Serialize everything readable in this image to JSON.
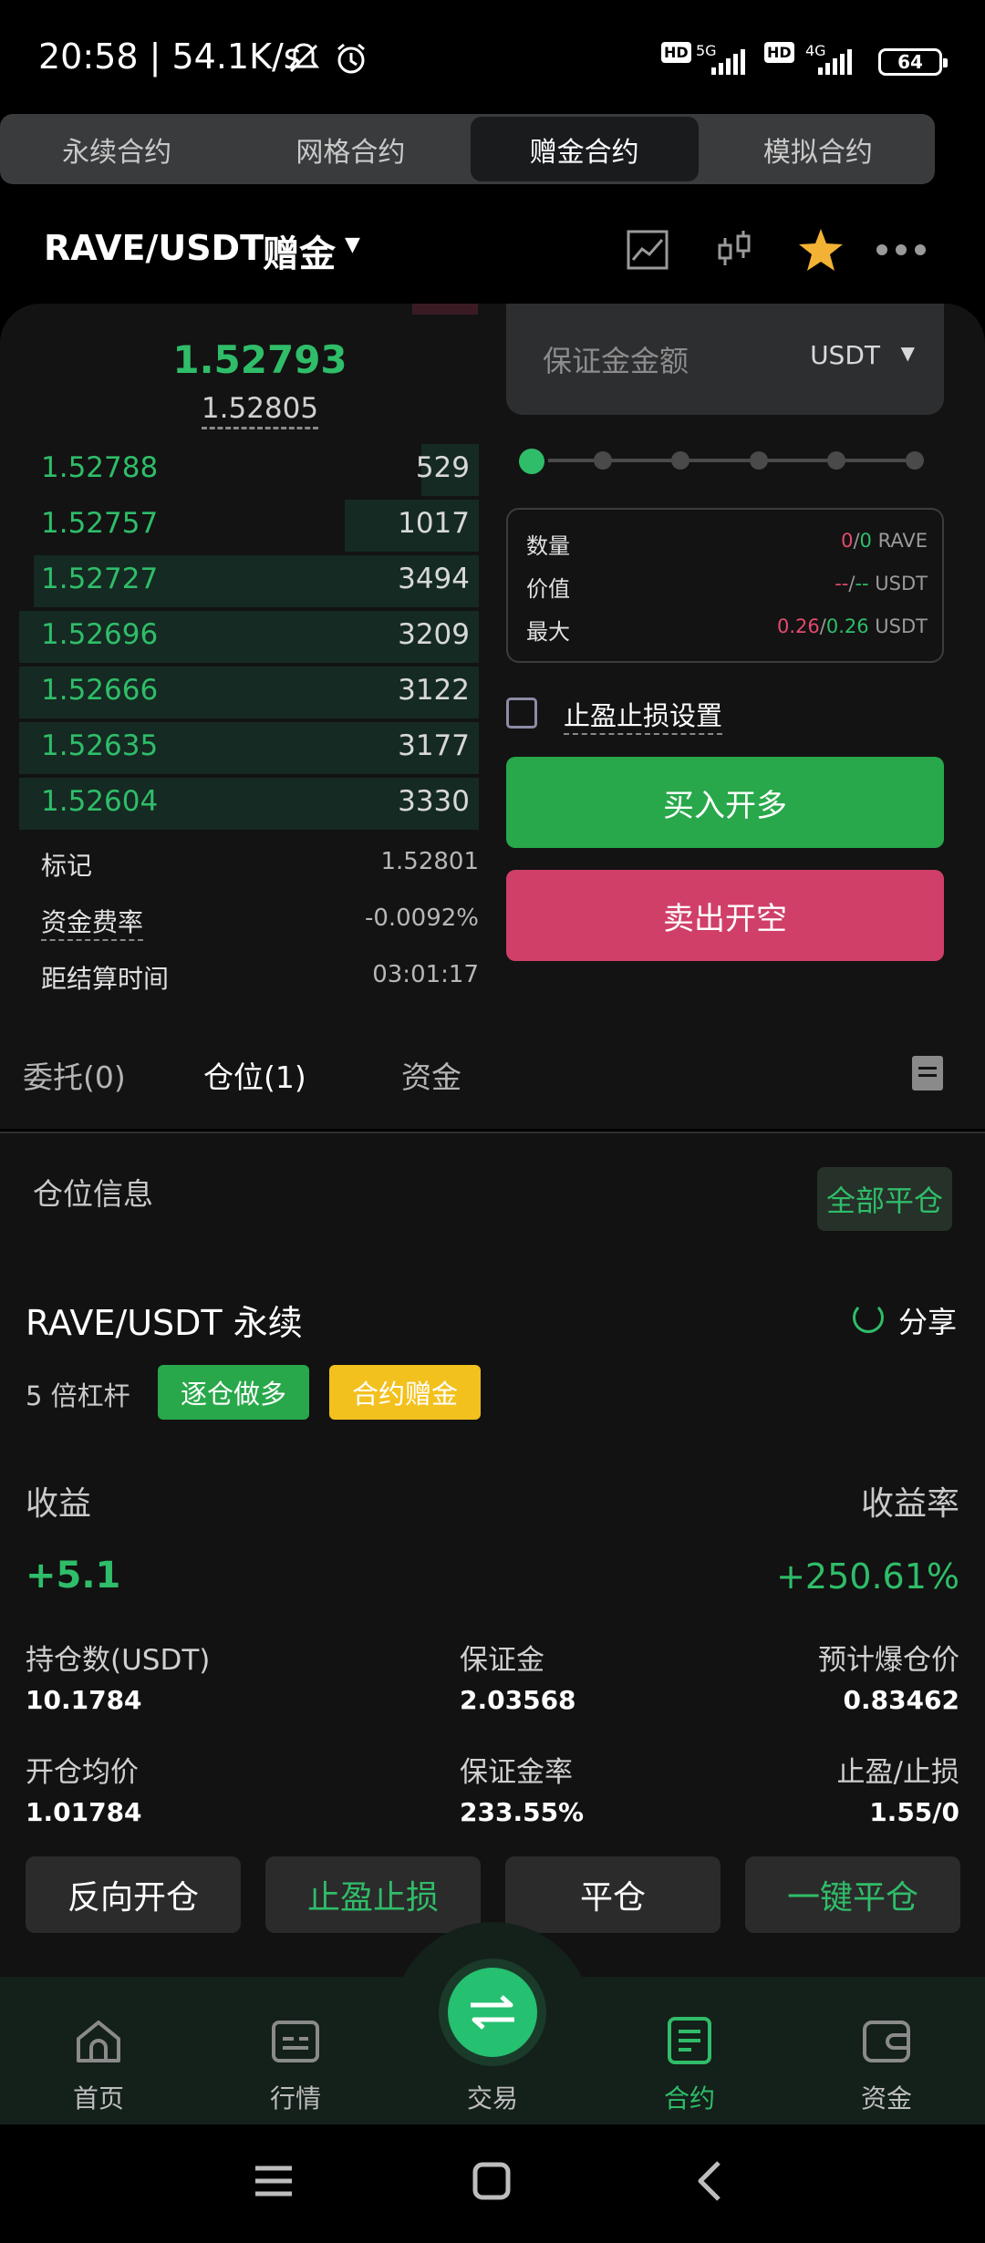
{
  "status_bar": {
    "time": "20:58 | 54.1K/s",
    "hd1": "HD",
    "net1": "5G",
    "hd2": "HD",
    "net2": "4G",
    "battery": "64"
  },
  "contract_tabs": [
    "永续合约",
    "网格合约",
    "赠金合约",
    "模拟合约"
  ],
  "pair_header": {
    "pair": "RAVE/USDT",
    "bonus_label": "赠金",
    "caret": "▼"
  },
  "orderbook": {
    "last_price": "1.52793",
    "index_price": "1.52805",
    "rows": [
      {
        "price": "1.52788",
        "qty": "529",
        "depth": 0.12
      },
      {
        "price": "1.52757",
        "qty": "1017",
        "depth": 0.28
      },
      {
        "price": "1.52727",
        "qty": "3494",
        "depth": 0.93
      },
      {
        "price": "1.52696",
        "qty": "3209",
        "depth": 0.96
      },
      {
        "price": "1.52666",
        "qty": "3122",
        "depth": 0.96
      },
      {
        "price": "1.52635",
        "qty": "3177",
        "depth": 0.96
      },
      {
        "price": "1.52604",
        "qty": "3330",
        "depth": 0.96
      }
    ],
    "mark_label": "标记",
    "mark_value": "1.52801",
    "funding_label": "资金费率",
    "funding_value": "-0.0092%",
    "settle_label": "距结算时间",
    "settle_value": "03:01:17"
  },
  "order_form": {
    "margin_placeholder": "保证金金额",
    "margin_unit": "USDT",
    "slider_value": 0,
    "qty_label": "数量",
    "qty_a": "0",
    "qty_b": "0",
    "qty_unit": "RAVE",
    "value_label": "价值",
    "value_a": "--",
    "value_b": "--",
    "value_unit": "USDT",
    "max_label": "最大",
    "max_a": "0.26",
    "max_b": "0.26",
    "max_unit": "USDT",
    "tpsl_label": "止盈止损设置",
    "buy_label": "买入开多",
    "sell_label": "卖出开空"
  },
  "sub_tabs": {
    "orders": "委托(0)",
    "positions": "仓位(1)",
    "funds": "资金"
  },
  "position": {
    "section_title": "仓位信息",
    "close_all": "全部平仓",
    "pair": "RAVE/USDT 永续",
    "share": "分享",
    "leverage": "5 倍杠杆",
    "badge_isolated": "逐仓做多",
    "badge_bonus": "合约赠金",
    "pnl_label": "收益",
    "roi_label": "收益率",
    "pnl_value": "+5.1",
    "roi_value": "+250.61%",
    "size_label": "持仓数(USDT)",
    "size_value": "10.1784",
    "margin_label": "保证金",
    "margin_value": "2.03568",
    "liq_label": "预计爆仓价",
    "liq_value": "0.83462",
    "entry_label": "开仓均价",
    "entry_value": "1.01784",
    "margin_ratio_label": "保证金率",
    "margin_ratio_value": "233.55%",
    "tpsl_label": "止盈/止损",
    "tpsl_value": "1.55/0"
  },
  "actions": [
    "反向开仓",
    "止盈止损",
    "平仓",
    "一键平仓"
  ],
  "bottom_nav": [
    "首页",
    "行情",
    "交易",
    "合约",
    "资金"
  ],
  "colors": {
    "green": "#2fbd69",
    "red": "#d03f68",
    "yellow": "#f3c11e"
  }
}
